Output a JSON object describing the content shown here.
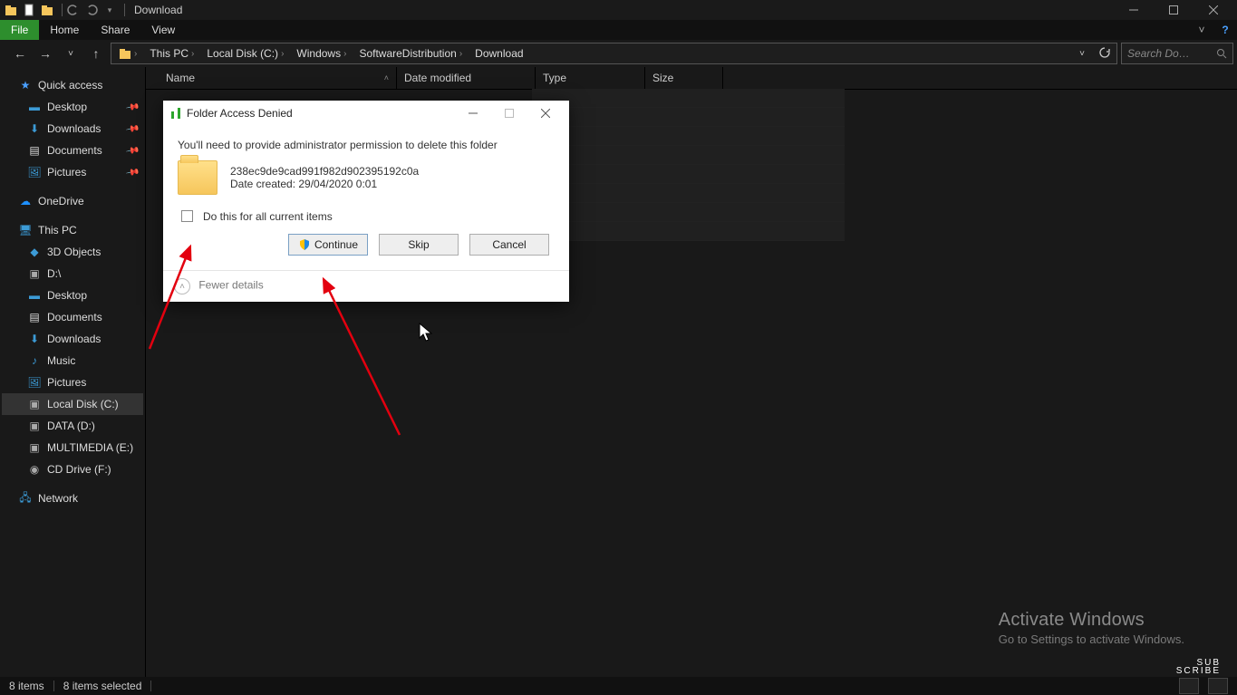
{
  "window": {
    "title": "Download",
    "min_aria": "Minimize",
    "max_aria": "Restore",
    "close_aria": "Close"
  },
  "ribbon": {
    "file": "File",
    "home": "Home",
    "share": "Share",
    "view": "View"
  },
  "address": {
    "segments": [
      "This PC",
      "Local Disk (C:)",
      "Windows",
      "SoftwareDistribution",
      "Download"
    ],
    "search_placeholder": "Search Do…"
  },
  "columns": {
    "name": "Name",
    "date": "Date modified",
    "type": "Type",
    "size": "Size"
  },
  "sidebar": {
    "quick_access": "Quick access",
    "qa": [
      {
        "label": "Desktop",
        "pin": true
      },
      {
        "label": "Downloads",
        "pin": true
      },
      {
        "label": "Documents",
        "pin": true
      },
      {
        "label": "Pictures",
        "pin": true
      }
    ],
    "onedrive": "OneDrive",
    "this_pc": "This PC",
    "pc": [
      {
        "label": "3D Objects"
      },
      {
        "label": "D:\\"
      },
      {
        "label": "Desktop"
      },
      {
        "label": "Documents"
      },
      {
        "label": "Downloads"
      },
      {
        "label": "Music"
      },
      {
        "label": "Pictures"
      },
      {
        "label": "Local Disk (C:)",
        "selected": true
      },
      {
        "label": "DATA (D:)"
      },
      {
        "label": "MULTIMEDIA (E:)"
      },
      {
        "label": "CD Drive (F:)"
      }
    ],
    "network": "Network"
  },
  "dialog": {
    "title": "Folder Access Denied",
    "message": "You'll need to provide administrator permission to delete this folder",
    "folder_name": "238ec9de9cad991f982d902395192c0a",
    "date_line": "Date created: 29/04/2020 0:01",
    "do_all": "Do this for all current items",
    "continue": "Continue",
    "skip": "Skip",
    "cancel": "Cancel",
    "fewer": "Fewer details"
  },
  "status": {
    "left1": "8 items",
    "left2": "8 items selected"
  },
  "watermark": {
    "h": "Activate Windows",
    "s": "Go to Settings to activate Windows."
  },
  "subscribe": {
    "a": "SUB",
    "b": "SCRIBE"
  }
}
